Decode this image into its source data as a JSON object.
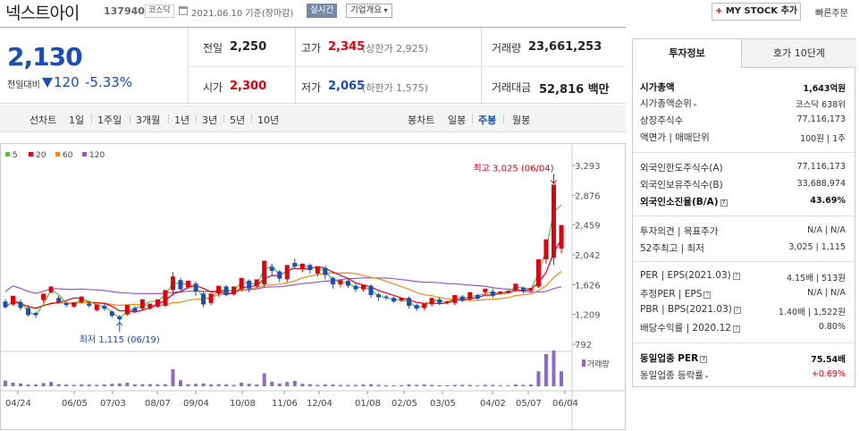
{
  "header": {
    "stock_name": "넥스트아이",
    "stock_code": "137940",
    "market_badge": "코스닥",
    "date_text": "2021.06.10 기준(장마감)",
    "realtime_label": "실시간",
    "company_overview_label": "기업개요",
    "mystock_plus": "+",
    "mystock_label": " MY STOCK 추가",
    "quick_order_label": "빠른주문"
  },
  "price": {
    "current": "2,130",
    "change_label": "전일대비",
    "change_value": "120",
    "change_pct": "-5.33%",
    "prev_close_label": "전일",
    "prev_close": "2,250",
    "open_label": "시가",
    "open": "2,300",
    "high_label": "고가",
    "high": "2,345",
    "upper_limit": "(상한가 2,925)",
    "low_label": "저가",
    "low": "2,065",
    "lower_limit": "(하한가 1,575)",
    "volume_label": "거래량",
    "volume": "23,661,253",
    "amount_label": "거래대금",
    "amount": "52,816 백만"
  },
  "period_tabs": {
    "line_chart": "선차트",
    "items": [
      "1일",
      "1주일",
      "3개월",
      "1년",
      "3년",
      "5년",
      "10년"
    ],
    "candle_chart": "봉차트",
    "candle_items": [
      "일봉",
      "주봉",
      "월봉"
    ],
    "active_candle": "주봉"
  },
  "colors": {
    "up": "#e2000f",
    "down": "#1a4db7",
    "ma5": "#5dbb3d",
    "ma20": "#e2000f",
    "ma60": "#f08a1c",
    "ma120": "#9a58c9"
  },
  "chart_data": {
    "type": "candlestick",
    "period": "weekly",
    "legend": [
      "5",
      "20",
      "60",
      "120"
    ],
    "y_ticks": [
      3293,
      2876,
      2459,
      2042,
      1626,
      1209,
      792
    ],
    "y_tick_labels": [
      "3,293",
      "2,876",
      "2,459",
      "2,042",
      "1,626",
      "1,209",
      "792"
    ],
    "x_labels": [
      "04/24",
      "06/05",
      "07/03",
      "08/07",
      "09/04",
      "10/08",
      "11/06",
      "12/04",
      "01/08",
      "02/05",
      "03/05",
      "04/02",
      "05/07",
      "06/04"
    ],
    "max_annotation": "최고 3,025 (06/04)",
    "min_annotation": "최저 1,115 (06/19)",
    "volume_label": "거래량",
    "candles": [
      [
        1390,
        1420,
        1310,
        1290
      ],
      [
        1350,
        1380,
        1470,
        1330
      ],
      [
        1380,
        1420,
        1300,
        1270
      ],
      [
        1300,
        1340,
        1200,
        1180
      ],
      [
        1230,
        1250,
        1200,
        1160
      ],
      [
        1410,
        1450,
        1500,
        1370
      ],
      [
        1520,
        1540,
        1600,
        1500
      ],
      [
        1440,
        1470,
        1380,
        1360
      ],
      [
        1370,
        1390,
        1340,
        1310
      ],
      [
        1320,
        1340,
        1380,
        1300
      ],
      [
        1380,
        1390,
        1460,
        1360
      ],
      [
        1360,
        1380,
        1330,
        1300
      ],
      [
        1270,
        1290,
        1350,
        1250
      ],
      [
        1330,
        1360,
        1290,
        1260
      ],
      [
        1250,
        1270,
        1190,
        1160
      ],
      [
        1180,
        1200,
        1140,
        1115
      ],
      [
        1210,
        1240,
        1340,
        1190
      ],
      [
        1300,
        1330,
        1250,
        1230
      ],
      [
        1290,
        1330,
        1420,
        1270
      ],
      [
        1290,
        1320,
        1360,
        1270
      ],
      [
        1320,
        1350,
        1420,
        1300
      ],
      [
        1330,
        1350,
        1550,
        1310
      ],
      [
        1550,
        1800,
        1740,
        1470
      ],
      [
        1690,
        1720,
        1560,
        1530
      ],
      [
        1590,
        1610,
        1680,
        1570
      ],
      [
        1640,
        1670,
        1530,
        1470
      ],
      [
        1500,
        1530,
        1350,
        1310
      ],
      [
        1370,
        1400,
        1500,
        1340
      ],
      [
        1500,
        1540,
        1610,
        1460
      ],
      [
        1600,
        1620,
        1480,
        1460
      ],
      [
        1490,
        1510,
        1600,
        1470
      ],
      [
        1560,
        1590,
        1720,
        1530
      ],
      [
        1680,
        1700,
        1570,
        1520
      ],
      [
        1600,
        1630,
        1700,
        1580
      ],
      [
        1630,
        1690,
        1960,
        1590
      ],
      [
        1870,
        1920,
        1820,
        1750
      ],
      [
        1810,
        1830,
        1710,
        1660
      ],
      [
        1700,
        1720,
        1900,
        1660
      ],
      [
        1930,
        1990,
        1880,
        1840
      ],
      [
        1850,
        1870,
        1920,
        1800
      ],
      [
        1900,
        1920,
        1830,
        1780
      ],
      [
        1780,
        1810,
        1870,
        1740
      ],
      [
        1860,
        1890,
        1760,
        1700
      ],
      [
        1720,
        1740,
        1630,
        1570
      ],
      [
        1630,
        1660,
        1690,
        1590
      ],
      [
        1680,
        1700,
        1610,
        1580
      ],
      [
        1610,
        1640,
        1560,
        1520
      ],
      [
        1560,
        1590,
        1620,
        1530
      ],
      [
        1610,
        1630,
        1480,
        1440
      ],
      [
        1490,
        1510,
        1450,
        1400
      ],
      [
        1460,
        1480,
        1440,
        1410
      ],
      [
        1440,
        1460,
        1390,
        1370
      ],
      [
        1400,
        1420,
        1440,
        1380
      ],
      [
        1440,
        1460,
        1330,
        1290
      ],
      [
        1340,
        1360,
        1290,
        1260
      ],
      [
        1300,
        1320,
        1360,
        1270
      ],
      [
        1350,
        1370,
        1440,
        1320
      ],
      [
        1420,
        1450,
        1370,
        1340
      ],
      [
        1380,
        1400,
        1390,
        1350
      ],
      [
        1370,
        1400,
        1480,
        1340
      ],
      [
        1460,
        1480,
        1400,
        1380
      ],
      [
        1420,
        1430,
        1520,
        1400
      ],
      [
        1480,
        1500,
        1430,
        1410
      ],
      [
        1520,
        1540,
        1570,
        1490
      ],
      [
        1530,
        1570,
        1470,
        1440
      ],
      [
        1500,
        1520,
        1530,
        1480
      ],
      [
        1520,
        1540,
        1540,
        1500
      ],
      [
        1550,
        1570,
        1640,
        1520
      ],
      [
        1580,
        1600,
        1530,
        1500
      ],
      [
        1540,
        1560,
        1580,
        1520
      ],
      [
        1600,
        1620,
        1980,
        1580
      ],
      [
        1980,
        2050,
        2260,
        1920
      ],
      [
        2000,
        2900,
        3025,
        1900
      ],
      [
        2130,
        2345,
        2460,
        2065
      ]
    ],
    "volumes": [
      0.16,
      0.1,
      0.08,
      0.05,
      0.05,
      0.09,
      0.12,
      0.06,
      0.05,
      0.04,
      0.05,
      0.05,
      0.04,
      0.05,
      0.07,
      0.08,
      0.1,
      0.05,
      0.06,
      0.06,
      0.05,
      0.06,
      0.48,
      0.17,
      0.06,
      0.07,
      0.08,
      0.05,
      0.06,
      0.05,
      0.04,
      0.1,
      0.07,
      0.05,
      0.36,
      0.13,
      0.08,
      0.12,
      0.15,
      0.07,
      0.06,
      0.04,
      0.05,
      0.05,
      0.04,
      0.04,
      0.04,
      0.05,
      0.06,
      0.04,
      0.03,
      0.03,
      0.03,
      0.05,
      0.04,
      0.05,
      0.04,
      0.03,
      0.03,
      0.04,
      0.04,
      0.04,
      0.03,
      0.04,
      0.04,
      0.03,
      0.03,
      0.05,
      0.04,
      0.05,
      0.42,
      0.9,
      1.0,
      0.42
    ]
  },
  "right_panel": {
    "tab_active": "투자정보",
    "tab_other": "호가 10단계",
    "rows": [
      {
        "label": "시가총액",
        "value": "1,643억원",
        "bold": true
      },
      {
        "label": "시가총액순위",
        "value": "코스닥 638위",
        "chevron": true
      },
      {
        "label": "상장주식수",
        "value": "77,116,173"
      },
      {
        "label": "액면가 | 매매단위",
        "value": "100원 | 1주"
      },
      {
        "label": "외국인한도주식수(A)",
        "value": "77,116,173"
      },
      {
        "label": "외국인보유주식수(B)",
        "value": "33,688,974"
      },
      {
        "label": "외국인소진율(B/A)",
        "value": "43.69%",
        "bold": true,
        "help": true
      },
      {
        "label": "투자의견 | 목표주가",
        "value": "N/A | N/A"
      },
      {
        "label": "52주최고 | 최저",
        "value": "3,025 | 1,115"
      },
      {
        "label": "PER | EPS(2021.03)",
        "value": "4.15배 | 513원",
        "help": true
      },
      {
        "label": "추정PER | EPS",
        "value": "N/A | N/A",
        "help": true
      },
      {
        "label": "PBR | BPS(2021.03)",
        "value": "1.40배 | 1,522원",
        "help": true
      },
      {
        "label": "배당수익률 | 2020.12",
        "value": "0.80%",
        "help": true
      },
      {
        "label": "동일업종 PER",
        "value": "75.54배",
        "bold": true,
        "help": true
      },
      {
        "label": "동일업종 등락률",
        "value": "+0.69%",
        "red": true,
        "chevron": true
      }
    ]
  }
}
